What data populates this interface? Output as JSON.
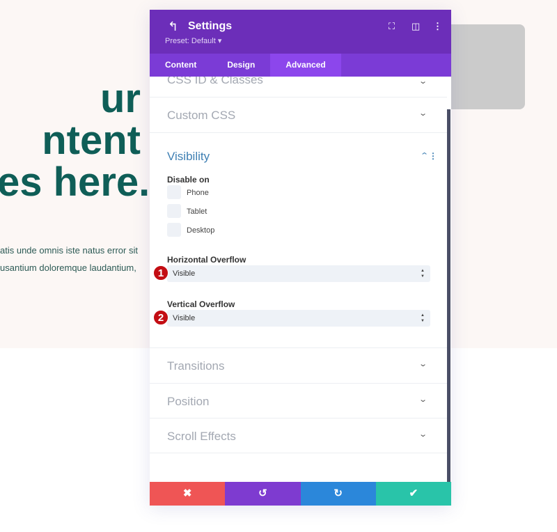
{
  "background": {
    "hero_lines": [
      "ur",
      "ntent",
      "es here."
    ],
    "paragraph_lines": [
      "atis unde omnis iste natus error sit",
      "usantium doloremque laudantium,"
    ]
  },
  "header": {
    "title": "Settings",
    "preset": "Preset: Default ▾",
    "color": "#6c2eb9"
  },
  "tabs": [
    {
      "label": "Content"
    },
    {
      "label": "Design"
    },
    {
      "label": "Advanced",
      "active": true
    }
  ],
  "sections": {
    "css_id": "CSS ID & Classes",
    "custom_css": "Custom CSS",
    "visibility": "Visibility",
    "transitions": "Transitions",
    "position": "Position",
    "scroll_effects": "Scroll Effects"
  },
  "visibility": {
    "disable_on_label": "Disable on",
    "options": [
      "Phone",
      "Tablet",
      "Desktop"
    ],
    "h_overflow_label": "Horizontal Overflow",
    "h_overflow_value": "Visible",
    "v_overflow_label": "Vertical Overflow",
    "v_overflow_value": "Visible"
  },
  "badges": [
    "1",
    "2"
  ],
  "footer": {
    "cancel_color": "#ef5555",
    "undo_color": "#7e3bd0",
    "redo_color": "#2b87da",
    "save_color": "#29c4a9"
  }
}
